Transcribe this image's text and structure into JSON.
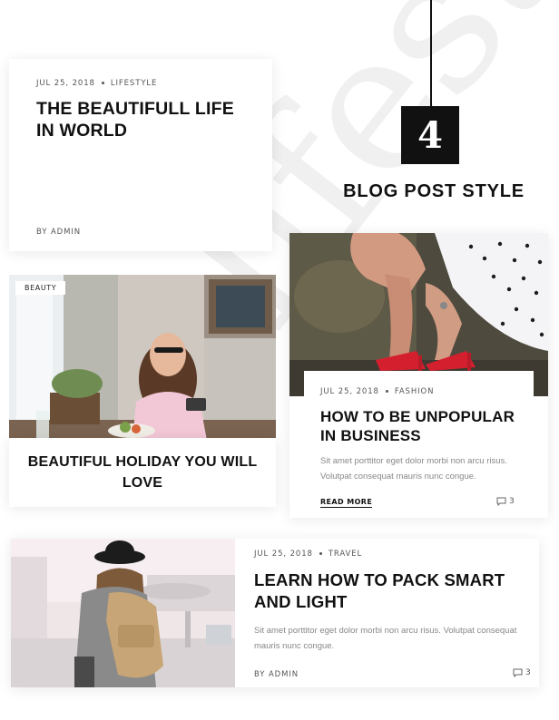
{
  "style_label": {
    "number": "4",
    "text": "BLOG POST STYLE"
  },
  "post1": {
    "date": "JUL 25, 2018",
    "category": "LIFESTYLE",
    "title": "THE BEAUTIFULL LIFE IN WORLD",
    "author": "BY ADMIN"
  },
  "post2": {
    "badge": "BEAUTY",
    "title": "BEAUTIFUL HOLIDAY YOU WILL LOVE"
  },
  "post3": {
    "date": "JUL 25, 2018",
    "category": "FASHION",
    "title": "HOW TO BE UNPOPULAR IN BUSINESS",
    "excerpt": "Sit amet porttitor eget dolor morbi non arcu risus. Volutpat consequat mauris nunc congue.",
    "read_more": "READ MORE",
    "comments": "3"
  },
  "post4": {
    "date": "JUL 25, 2018",
    "category": "TRAVEL",
    "title": "LEARN HOW TO PACK SMART AND LIGHT",
    "excerpt": "Sit amet porttitor eget dolor morbi non arcu risus. Volutpat consequat mauris nunc congue.",
    "author": "BY ADMIN",
    "comments": "3"
  },
  "icons": {
    "comment": "comment-bubble-icon"
  }
}
